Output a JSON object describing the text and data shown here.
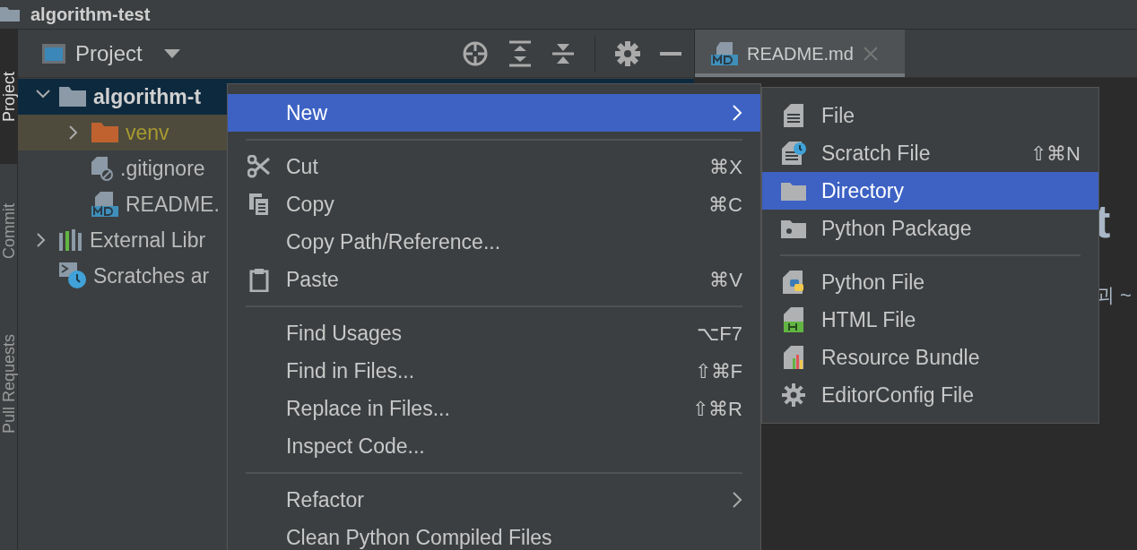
{
  "title_bar": {
    "title": "algorithm-test"
  },
  "tool_strip": {
    "tabs": [
      {
        "label": "Project",
        "selected": true
      },
      {
        "label": "Commit",
        "selected": false
      },
      {
        "label": "Pull Requests",
        "selected": false
      }
    ]
  },
  "project_panel": {
    "title": "Project",
    "tree": [
      {
        "kind": "folder",
        "label": "algorithm-t",
        "bold": true,
        "selected": true,
        "expanded": true,
        "children": [
          {
            "kind": "folder",
            "label": "venv",
            "excluded": true,
            "selected": false,
            "expanded": false
          },
          {
            "kind": "ignore-file",
            "label": ".gitignore",
            "selected": false
          },
          {
            "kind": "md-file",
            "label": "README.",
            "selected": false
          }
        ]
      },
      {
        "kind": "library",
        "label": "External Libr",
        "selected": false,
        "expanded": false
      },
      {
        "kind": "scratches",
        "label": "Scratches ar",
        "selected": false
      }
    ]
  },
  "editor": {
    "tabs": [
      {
        "label": "README.md",
        "selected": true
      }
    ],
    "heading_fragment": "t",
    "text_fragment": "괴 ~"
  },
  "context_menu": {
    "items": [
      {
        "kind": "item",
        "label": "New",
        "selected": true,
        "submenu": true
      },
      {
        "kind": "separator"
      },
      {
        "kind": "item",
        "label": "Cut",
        "shortcut": "⌘X",
        "selected": false
      },
      {
        "kind": "item",
        "label": "Copy",
        "shortcut": "⌘C",
        "selected": false
      },
      {
        "kind": "item",
        "label": "Copy Path/Reference...",
        "selected": false
      },
      {
        "kind": "item",
        "label": "Paste",
        "shortcut": "⌘V",
        "selected": false
      },
      {
        "kind": "separator"
      },
      {
        "kind": "item",
        "label": "Find Usages",
        "shortcut": "⌥F7",
        "selected": false
      },
      {
        "kind": "item",
        "label": "Find in Files...",
        "shortcut": "⇧⌘F",
        "selected": false
      },
      {
        "kind": "item",
        "label": "Replace in Files...",
        "shortcut": "⇧⌘R",
        "selected": false
      },
      {
        "kind": "item",
        "label": "Inspect Code...",
        "selected": false
      },
      {
        "kind": "separator"
      },
      {
        "kind": "item",
        "label": "Refactor",
        "selected": false,
        "submenu": true
      },
      {
        "kind": "item",
        "label": "Clean Python Compiled Files",
        "selected": false
      }
    ]
  },
  "new_submenu": {
    "items": [
      {
        "kind": "item",
        "label": "File",
        "selected": false
      },
      {
        "kind": "item",
        "label": "Scratch File",
        "shortcut": "⇧⌘N",
        "selected": false
      },
      {
        "kind": "item",
        "label": "Directory",
        "selected": true
      },
      {
        "kind": "item",
        "label": "Python Package",
        "selected": false
      },
      {
        "kind": "separator"
      },
      {
        "kind": "item",
        "label": "Python File",
        "selected": false
      },
      {
        "kind": "item",
        "label": "HTML File",
        "selected": false
      },
      {
        "kind": "item",
        "label": "Resource Bundle",
        "selected": false
      },
      {
        "kind": "item",
        "label": "EditorConfig File",
        "selected": false
      }
    ]
  }
}
